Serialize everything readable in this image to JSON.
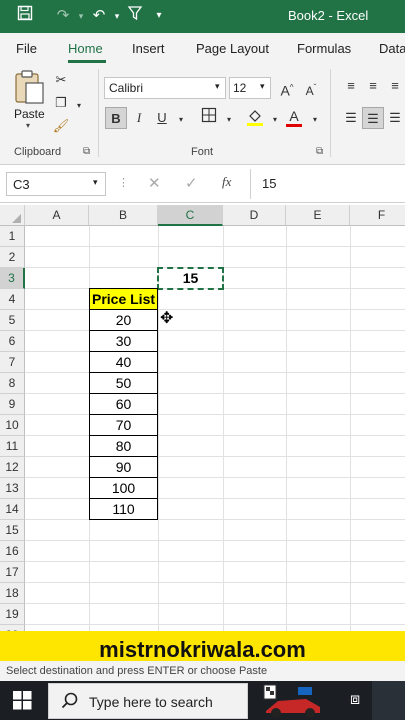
{
  "title_bar": {
    "document_title": "Book2 - Excel",
    "accent_color": "#217346"
  },
  "tabs": [
    {
      "label": "File"
    },
    {
      "label": "Home",
      "active": true
    },
    {
      "label": "Insert"
    },
    {
      "label": "Page Layout"
    },
    {
      "label": "Formulas"
    },
    {
      "label": "Data"
    }
  ],
  "ribbon": {
    "clipboard": {
      "paste_label": "Paste",
      "group_label": "Clipboard"
    },
    "font": {
      "font_name": "Calibri",
      "font_size": "12",
      "group_label": "Font",
      "bold": "B",
      "italic": "I",
      "underline": "U",
      "grow": "A",
      "shrink": "A",
      "font_color_letter": "A"
    }
  },
  "formula_bar": {
    "name_box": "C3",
    "fx_label": "fx",
    "value": "15"
  },
  "grid": {
    "columns": [
      "A",
      "B",
      "C",
      "D",
      "E",
      "F"
    ],
    "rows": [
      "1",
      "2",
      "3",
      "4",
      "5",
      "6",
      "7",
      "8",
      "9",
      "10",
      "11",
      "12",
      "13",
      "14",
      "15",
      "16",
      "17",
      "18",
      "19",
      "20"
    ],
    "selected_cell": "C3",
    "c3_value": "15",
    "price_header": "Price List",
    "price_header_fill": "#ffff00",
    "price_values": [
      "20",
      "30",
      "40",
      "50",
      "60",
      "70",
      "80",
      "90",
      "100",
      "110"
    ]
  },
  "banner": {
    "text": "mistrnokriwala.com",
    "color": "#ffe600"
  },
  "status_bar": {
    "text": "Select destination and press ENTER or choose Paste"
  },
  "taskbar": {
    "search_placeholder": "Type here to search"
  }
}
